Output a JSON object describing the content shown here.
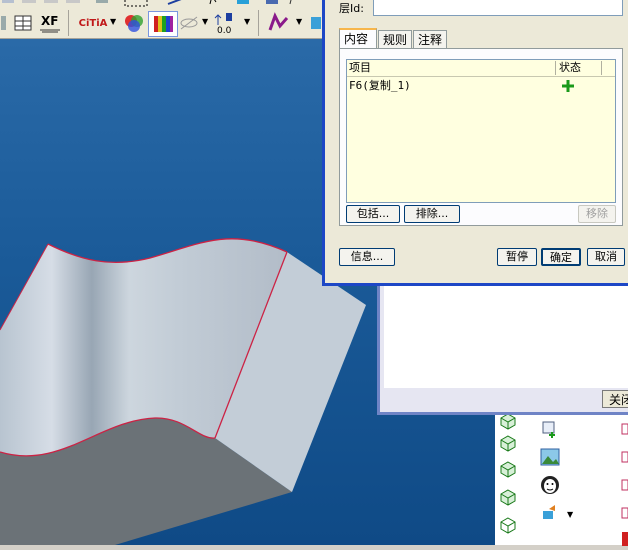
{
  "dialog": {
    "layer_id_label": "层Id:",
    "layer_id_value": "",
    "tabs": [
      {
        "label": "内容",
        "active": true
      },
      {
        "label": "规则",
        "active": false
      },
      {
        "label": "注释",
        "active": false
      }
    ],
    "list": {
      "columns": [
        "项目",
        "状态"
      ],
      "rows": [
        {
          "item": "F6(复制_1)",
          "status_icon": "green-plus-icon"
        }
      ]
    },
    "include_button": "包括...",
    "exclude_button": "排除...",
    "remove_button": "移除",
    "info_button": "信息...",
    "pause_button": "暂停",
    "ok_button": "确定",
    "cancel_button": "取消"
  },
  "background_window": {
    "close_button": "关闭"
  },
  "toolbar": {
    "citia_label": "CiTiA",
    "xf_label": "XF"
  },
  "colors": {
    "surface_edge": "#cc2244",
    "dialog_frame": "#1d47c6",
    "plus_green": "#1a9a1a"
  }
}
